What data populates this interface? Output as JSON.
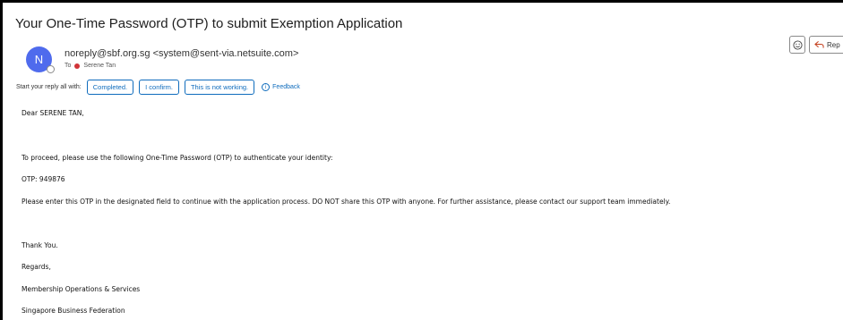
{
  "email": {
    "subject": "Your One-Time Password (OTP) to submit Exemption Application",
    "avatar_initial": "N",
    "sender": "noreply@sbf.org.sg <system@sent-via.netsuite.com>",
    "to_label": "To",
    "recipient": "Serene Tan",
    "actions": {
      "reply_label": "Rep"
    }
  },
  "suggested_replies": {
    "prompt": "Start your reply all with:",
    "options": [
      "Completed.",
      "I confirm.",
      "This is not working."
    ],
    "feedback_label": "Feedback"
  },
  "body": {
    "greeting": "Dear SERENE TAN,",
    "intro": "To proceed, please use the following One-Time Password (OTP) to authenticate your identity:",
    "otp_line": "OTP: 949876",
    "instruction": "Please enter this OTP in the designated field to continue with the application process. DO NOT share this OTP with anyone. For further assistance, please contact our support team immediately.",
    "thanks": "Thank You.",
    "regards": "Regards,",
    "department": "Membership Operations & Services",
    "organization": "Singapore Business Federation"
  },
  "colors": {
    "avatar": "#4f6bed",
    "accent": "#0f6cbd",
    "recipient_dot": "#d13438"
  }
}
